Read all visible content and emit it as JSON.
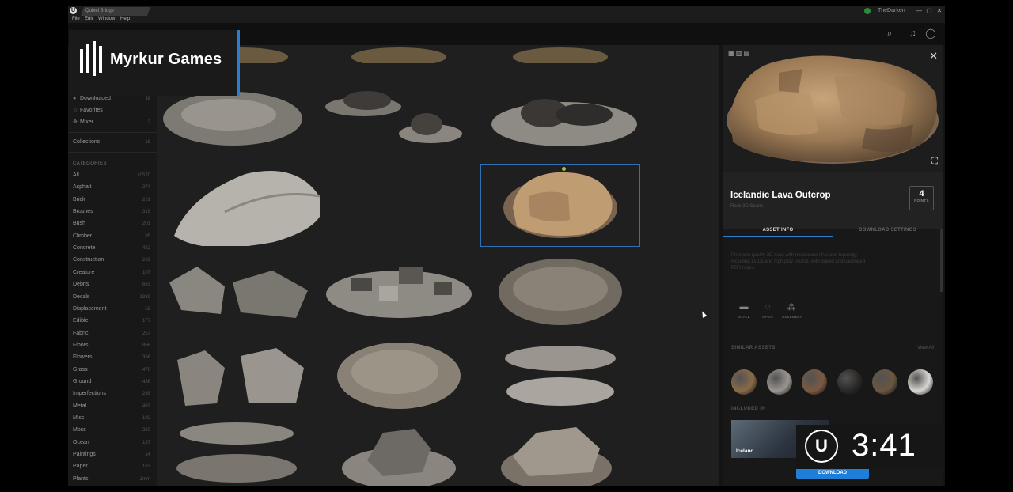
{
  "window": {
    "tab_title": "Quixel Bridge",
    "user_name": "TheDarken",
    "controls": {
      "minimize": "—",
      "maximize": "▢",
      "close": "✕"
    }
  },
  "menu": [
    "File",
    "Edit",
    "Window",
    "Help"
  ],
  "brand": {
    "name": "Myrkur Games"
  },
  "sidebar": {
    "top_items": [
      {
        "label": "Downloaded",
        "count": "38",
        "icon": "check-circle-icon"
      },
      {
        "label": "Favorites",
        "count": "",
        "icon": "star-icon"
      },
      {
        "label": "Mixer",
        "count": "2",
        "icon": "mixer-icon"
      }
    ],
    "collections": {
      "label": "Collections",
      "count": "18"
    },
    "categories_heading": "CATEGORIES",
    "categories": [
      {
        "label": "All",
        "count": "10570"
      },
      {
        "label": "Asphalt",
        "count": "274"
      },
      {
        "label": "Brick",
        "count": "261"
      },
      {
        "label": "Brushes",
        "count": "319"
      },
      {
        "label": "Bush",
        "count": "201"
      },
      {
        "label": "Climber",
        "count": "85"
      },
      {
        "label": "Concrete",
        "count": "452"
      },
      {
        "label": "Construction",
        "count": "269"
      },
      {
        "label": "Creature",
        "count": "107"
      },
      {
        "label": "Debris",
        "count": "663"
      },
      {
        "label": "Decals",
        "count": "1389"
      },
      {
        "label": "Displacement",
        "count": "52"
      },
      {
        "label": "Edible",
        "count": "177"
      },
      {
        "label": "Fabric",
        "count": "257"
      },
      {
        "label": "Floors",
        "count": "866"
      },
      {
        "label": "Flowers",
        "count": "356"
      },
      {
        "label": "Grass",
        "count": "470"
      },
      {
        "label": "Ground",
        "count": "436"
      },
      {
        "label": "Imperfections",
        "count": "288"
      },
      {
        "label": "Metal",
        "count": "493"
      },
      {
        "label": "Misc",
        "count": "192"
      },
      {
        "label": "Moss",
        "count": "250"
      },
      {
        "label": "Ocean",
        "count": "137"
      },
      {
        "label": "Paintings",
        "count": "14"
      },
      {
        "label": "Paper",
        "count": "163"
      },
      {
        "label": "Plants",
        "count": "2mm"
      }
    ]
  },
  "panel": {
    "asset_title": "Icelandic Lava Outcrop",
    "asset_sub": "Rock 3D Scans",
    "points_value": "4",
    "points_label": "POINTS",
    "tabs": [
      "ASSET INFO",
      "DOWNLOAD SETTINGS"
    ],
    "description": "Premium quality 3D scan with meticulous UVs and topology, including LODs and high poly source, with baked and calibrated PBR maps.",
    "features": [
      {
        "label": "SCALE",
        "icon": "scale-icon"
      },
      {
        "label": "OPEN",
        "icon": "open-icon"
      },
      {
        "label": "ASSEMBLY",
        "icon": "assembly-icon"
      }
    ],
    "similar_label": "SIMILAR ASSETS",
    "view_all": "View All",
    "included_label": "INCLUDED IN",
    "included_item": "Iceland",
    "download_label": "DOWNLOAD",
    "swatch_colors": [
      "#8a6a48",
      "#9a9590",
      "#7a5a42",
      "#2a2826",
      "#6b5640",
      "#d8d6d2"
    ]
  },
  "timer": {
    "time": "3:41"
  }
}
